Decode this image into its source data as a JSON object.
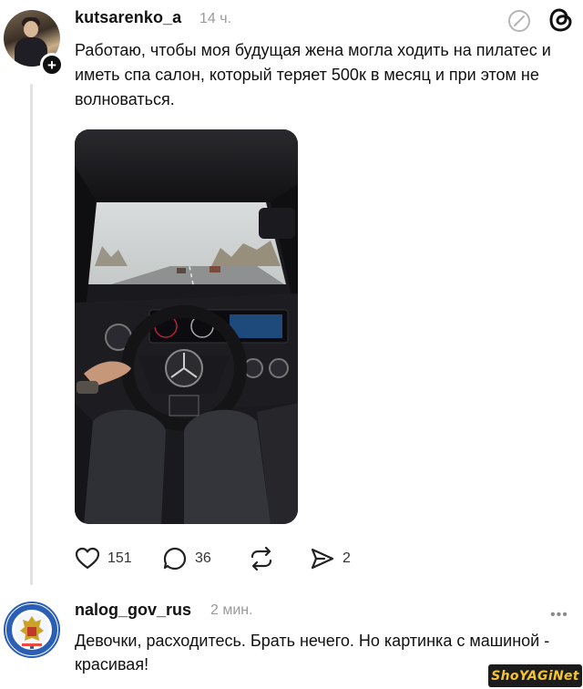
{
  "post": {
    "username": "kutsarenko_a",
    "time": "14 ч.",
    "text": "Работаю, чтобы моя будущая жена могла ходить на пилатес и иметь спа салон, который теряет 500к в месяц и при этом не волноваться.",
    "media_icon": "car-interior-photo",
    "likes": "151",
    "comments": "36",
    "shares": "2"
  },
  "reply": {
    "username": "nalog_gov_rus",
    "time": "2 мин.",
    "more": "•••",
    "text": "Девочки, расходитесь. Брать нечего. Но картинка с машиной - красивая!"
  },
  "watermark": "ShoYAGiNet",
  "colors": {
    "text": "#111111",
    "muted": "#9a9a9a",
    "thread_line": "#e2e2e2",
    "watermark_bg": "#1c1c1c",
    "watermark_fg": "#f4c430"
  }
}
